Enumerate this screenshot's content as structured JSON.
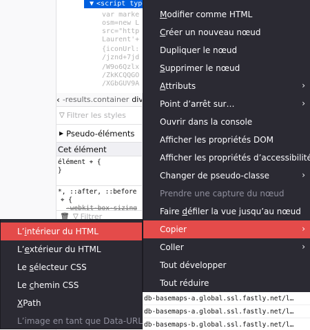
{
  "markup": {
    "selected_line": "<script type=\"text/javascript\" src=\"data:text/jav",
    "lines": [
      "var marke",
      "osm=new L",
      "src=\"http",
      "Laurent'+",
      "{iconUrl:",
      "/jznd+7jd",
      "/W9o6Qzlx",
      "/ZkKCQQGO",
      "/XGbGUV9A"
    ]
  },
  "rules": {
    "breadcrumb": "-results.container",
    "breadcrumb_next": "div",
    "filter_placeholder": "Filtrer les styles",
    "pseudo_label": "Pseudo-éléments",
    "section_title": "Cet élément",
    "element_rule": [
      "élément",
      "{",
      "}"
    ],
    "universal_selector": "*, ::after, ::before",
    "universal_prop": "-webkit-box-sizing",
    "bottom_filter": "Filtrer"
  },
  "net_rows": [
    "db-basemaps-a.global.ssl.fastly.net/l…",
    "db-basemaps-a.global.ssl.fastly.net/l…",
    "db-basemaps-b.global.ssl.fastly.net/l…"
  ],
  "menu": {
    "items": [
      {
        "label": "Modifier comme HTML",
        "accel": "M",
        "rest": "odifier comme HTML"
      },
      {
        "label": "Créer un nouveau nœud",
        "accel": "C",
        "rest": "réer un nouveau nœud"
      },
      {
        "label": "Dupliquer le nœud"
      },
      {
        "label": "Supprimer le nœud",
        "accel": "S",
        "rest": "upprimer le nœud"
      },
      {
        "label": "Attributs",
        "accel": "A",
        "rest": "ttributs"
      },
      {
        "label": "Point d’arrêt sur…"
      },
      {
        "label": "Ouvrir dans la console"
      },
      {
        "label": "Afficher les propriétés DOM"
      },
      {
        "label": "Afficher les propriétés d’accessibilité"
      },
      {
        "label": "Changer de pseudo-classe"
      },
      {
        "label": "Prendre une capture du nœud"
      },
      {
        "label": "Faire défiler la vue jusqu’au nœud",
        "pre": "Faire ",
        "accel": "d",
        "rest": "éfiler la vue jusqu’au nœud"
      },
      {
        "label": "Copier"
      },
      {
        "label": "Coller"
      },
      {
        "label": "Tout développer"
      },
      {
        "label": "Tout réduire"
      }
    ],
    "submenu_arrow": "›"
  },
  "submenu": {
    "items": [
      {
        "label": "L’intérieur du HTML",
        "pre": "L’",
        "accel": "i",
        "rest": "ntérieur du HTML"
      },
      {
        "label": "L’extérieur du HTML",
        "pre": "L’",
        "accel": "e",
        "rest": "xtérieur du HTML"
      },
      {
        "label": "Le sélecteur CSS",
        "pre": "Le ",
        "accel": "s",
        "rest": "électeur CSS"
      },
      {
        "label": "Le chemin CSS",
        "pre": "Le ",
        "accel": "c",
        "rest": "hemin CSS"
      },
      {
        "label": "XPath",
        "accel": "X",
        "rest": "Path"
      },
      {
        "label": "L’image en tant que Data-URL"
      }
    ]
  },
  "colors": {
    "menu_bg": "#2b2a33",
    "highlight": "#e44b4a",
    "selection_blue": "#0060df",
    "disabled_text": "#8f8f9d"
  }
}
